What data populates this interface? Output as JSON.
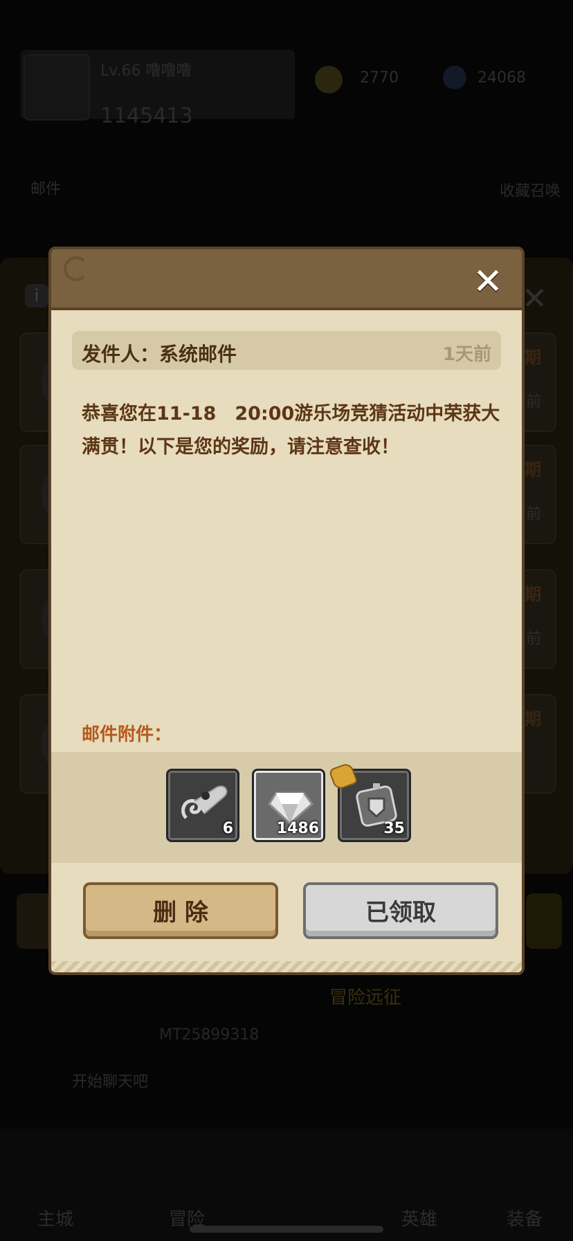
{
  "background": {
    "player_name": "Lv.66 噜噜噜",
    "player_id": "1145413",
    "coins": "2770",
    "gems": "24068",
    "left_label": "邮件",
    "right_label": "收藏召唤",
    "under_list_tags": [
      "期",
      "前",
      "期",
      "前",
      "期",
      "前",
      "期"
    ],
    "adventure_label": "冒险远征",
    "cid": "MT25899318",
    "ticker": "开始聊天吧",
    "nav_items": [
      "主城",
      "冒险",
      "英雄",
      "装备"
    ]
  },
  "mail": {
    "close_icon": "close-icon",
    "sender_label": "发件人：系统邮件",
    "time_ago": "1天前",
    "message": "恭喜您在11-18　20:00游乐场竞猜活动中荣获大满贯！以下是您的奖励，请注意查收！",
    "attachments_label": "邮件附件：",
    "attachments": [
      {
        "icon": "scroll-icon",
        "count": "6"
      },
      {
        "icon": "diamond-icon",
        "count": "1486"
      },
      {
        "icon": "armor-token-icon",
        "count": "35"
      }
    ],
    "delete_label": "删 除",
    "claimed_label": "已领取"
  },
  "colors": {
    "header": "#7a6140",
    "body": "#e7dcbd",
    "text_brown": "#5b3617",
    "accent_orange": "#b6581d"
  }
}
